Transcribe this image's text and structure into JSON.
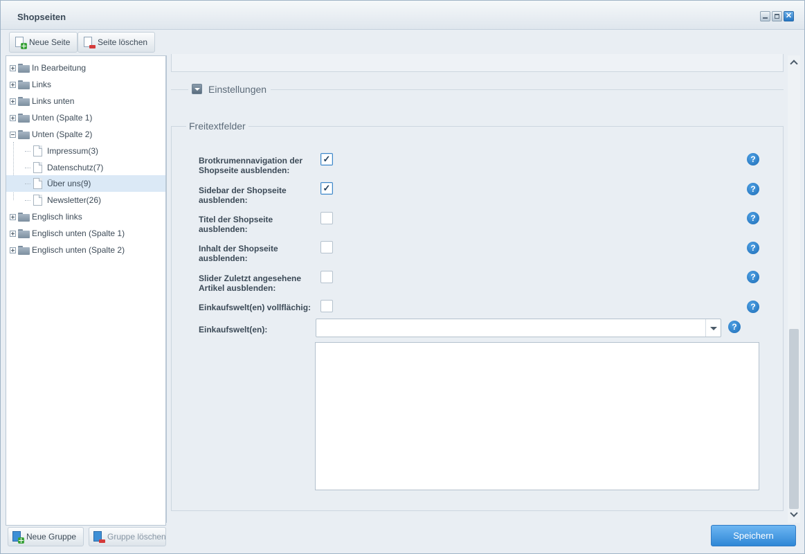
{
  "window": {
    "title": "Shopseiten"
  },
  "toolbar": {
    "new_page": "Neue Seite",
    "delete_page": "Seite löschen"
  },
  "tree": {
    "items": [
      {
        "label": "In Bearbeitung",
        "type": "group",
        "expanded": false
      },
      {
        "label": "Links",
        "type": "group",
        "expanded": false
      },
      {
        "label": "Links unten",
        "type": "group",
        "expanded": false
      },
      {
        "label": "Unten (Spalte 1)",
        "type": "group",
        "expanded": false
      },
      {
        "label": "Unten (Spalte 2)",
        "type": "group",
        "expanded": true
      },
      {
        "label": "Impressum(3)",
        "type": "page"
      },
      {
        "label": "Datenschutz(7)",
        "type": "page"
      },
      {
        "label": "Über uns(9)",
        "type": "page",
        "selected": true
      },
      {
        "label": "Newsletter(26)",
        "type": "page"
      },
      {
        "label": "Englisch links",
        "type": "group",
        "expanded": false
      },
      {
        "label": "Englisch unten (Spalte 1)",
        "type": "group",
        "expanded": false
      },
      {
        "label": "Englisch unten (Spalte 2)",
        "type": "group",
        "expanded": false
      }
    ]
  },
  "bottombar": {
    "new_group": "Neue Gruppe",
    "delete_group": "Gruppe löschen"
  },
  "form": {
    "settings_legend": "Einstellungen",
    "freetext_legend": "Freitextfelder",
    "fields": [
      {
        "label": "Brotkrumennavigation der Shopseite ausblenden:",
        "checked": true
      },
      {
        "label": "Sidebar der Shopseite ausblenden:",
        "checked": true
      },
      {
        "label": "Titel der Shopseite ausblenden:",
        "checked": false
      },
      {
        "label": "Inhalt der Shopseite ausblenden:",
        "checked": false
      },
      {
        "label": "Slider Zuletzt angesehene Artikel ausblenden:",
        "checked": false
      },
      {
        "label": "Einkaufswelt(en) vollflächig:",
        "checked": false
      }
    ],
    "shopping_worlds_label": "Einkaufswelt(en):",
    "shopping_worlds_value": "",
    "help_glyph": "?",
    "check_glyph": "✓"
  },
  "footer": {
    "save": "Speichern"
  },
  "colors": {
    "accent": "#2f87d6",
    "help": "#1d6cb5",
    "selected_row": "#dbe9f6"
  }
}
